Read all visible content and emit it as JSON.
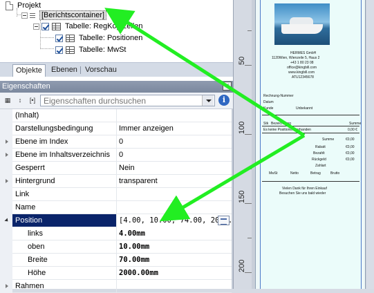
{
  "tree": {
    "root": "Projekt",
    "container": "[Berichtscontainer]",
    "items": [
      "Tabelle: RegKopfzeilen",
      "Tabelle: Positionen",
      "Tabelle: MwSt"
    ]
  },
  "tabs": [
    "Objekte",
    "Ebenen",
    "Vorschau"
  ],
  "properties": {
    "title": "Eigenschaften",
    "close": "×",
    "search_placeholder": "Eigenschaften durchsuchen",
    "info": "i",
    "toolbar_icons": [
      "sort-categorized-icon",
      "sort-alpha-icon",
      "formula-icon"
    ],
    "rows": [
      {
        "name": "(Inhalt)",
        "value": ""
      },
      {
        "name": "Darstellungsbedingung",
        "value": "Immer anzeigen"
      },
      {
        "name": "Ebene im Index",
        "value": "0"
      },
      {
        "name": "Ebene im Inhaltsverzeichnis",
        "value": "0"
      },
      {
        "name": "Gesperrt",
        "value": "Nein"
      },
      {
        "name": "Hintergrund",
        "value": "transparent"
      },
      {
        "name": "Link",
        "value": ""
      },
      {
        "name": "Name",
        "value": ""
      },
      {
        "name": "Position",
        "value": "[4.00, 10.00, 74.00, 2010.0..."
      },
      {
        "name": "links",
        "value": "4.00mm"
      },
      {
        "name": "oben",
        "value": "10.00mm"
      },
      {
        "name": "Breite",
        "value": "70.00mm"
      },
      {
        "name": "Höhe",
        "value": "2000.00mm"
      },
      {
        "name": "Rahmen",
        "value": ""
      }
    ]
  },
  "ruler": {
    "labels": [
      "50",
      "100",
      "150",
      "200"
    ]
  },
  "receipt": {
    "company": "HERMES GmbH",
    "address1": "1120Wien, Wienzeile 5, Haus 2",
    "phone": "+43 1 80 23 08",
    "email": "office@kingbill.com",
    "web": "www.kingbill.com",
    "uid": "ATU12345678",
    "rechnung": "Rechnung-Nummer",
    "datum": "Datum",
    "kunde": "Kunde",
    "unbekannt": "Unbekannt",
    "col_pos": "Stk",
    "col_bez": "Bezeichnung",
    "col_sum": "Summe",
    "no_pos": "Es keine Positionen vorhanden",
    "no_pos_val": "0,00 €",
    "summe": "Summe",
    "summe_val": "€0,00",
    "rabatt": "Rabatt",
    "bezahlt": "Bezahlt",
    "rueckgeld": "Rückgeld",
    "zero": "€0,00",
    "zahlart": "Zahlart",
    "mwst_cols": [
      "MwSt",
      "Netto",
      "Betrag",
      "Brutto"
    ],
    "footer1": "Vielen Dank für Ihren Einkauf",
    "footer2": "Besuchen Sie uns bald wieder"
  }
}
